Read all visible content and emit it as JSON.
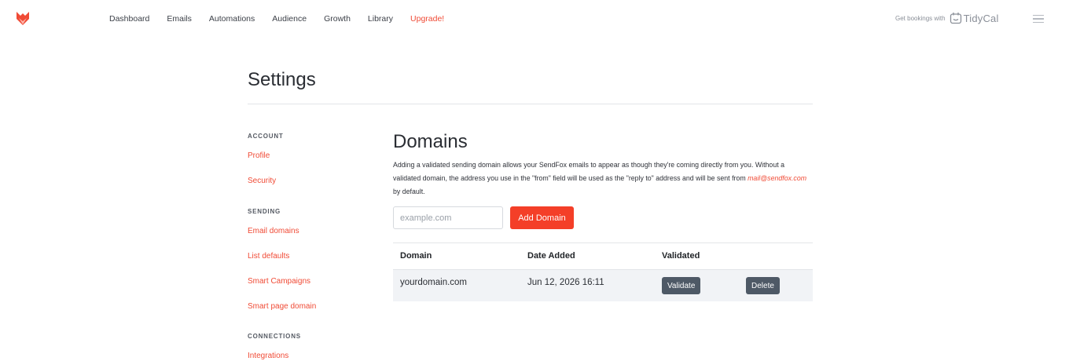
{
  "nav": {
    "items": [
      "Dashboard",
      "Emails",
      "Automations",
      "Audience",
      "Growth",
      "Library"
    ],
    "upgrade": "Upgrade!",
    "promo_text": "Get bookings with",
    "promo_brand": "TidyCal"
  },
  "page": {
    "title": "Settings"
  },
  "sidebar": {
    "account_heading": "ACCOUNT",
    "profile": "Profile",
    "security": "Security",
    "sending_heading": "SENDING",
    "email_domains": "Email domains",
    "list_defaults": "List defaults",
    "smart_campaigns": "Smart Campaigns",
    "smart_page_domain": "Smart page domain",
    "connections_heading": "CONNECTIONS",
    "integrations": "Integrations"
  },
  "domains": {
    "title": "Domains",
    "desc_part1": "Adding a validated sending domain allows your SendFox emails to appear as though they're coming directly from you. Without a validated domain, the address you use in the \"from\" field will be used as the \"reply to\" address and will be sent from ",
    "desc_email": "mail@sendfox.com",
    "desc_part2": " by default.",
    "input_placeholder": "example.com",
    "add_button": "Add Domain",
    "columns": {
      "domain": "Domain",
      "date_added": "Date Added",
      "validated": "Validated"
    },
    "rows": [
      {
        "domain": "yourdomain.com",
        "date_added": "Jun 12, 2026 16:11",
        "validate_label": "Validate",
        "delete_label": "Delete"
      }
    ]
  },
  "colors": {
    "accent": "#f04b36",
    "button": "#f43f28",
    "dark_button": "#4e5966"
  }
}
